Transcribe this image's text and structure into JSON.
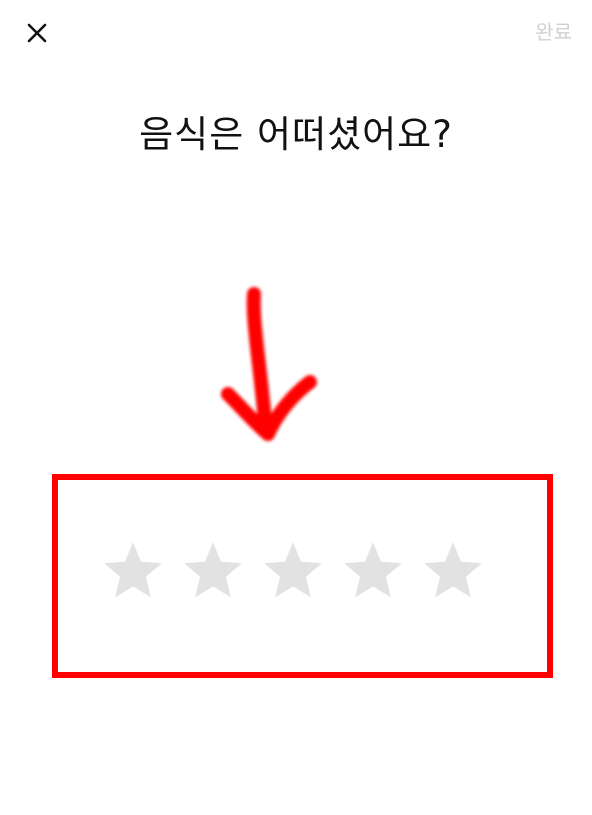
{
  "header": {
    "done_label": "완료",
    "close_icon": "close-icon"
  },
  "question": {
    "text": "음식은 어떠셨어요?"
  },
  "rating": {
    "max_stars": 5,
    "value": 0,
    "empty_color": "#e2e2e2"
  },
  "annotation": {
    "color": "#ff0000",
    "arrow_icon": "hand-drawn-arrow-down-icon"
  }
}
